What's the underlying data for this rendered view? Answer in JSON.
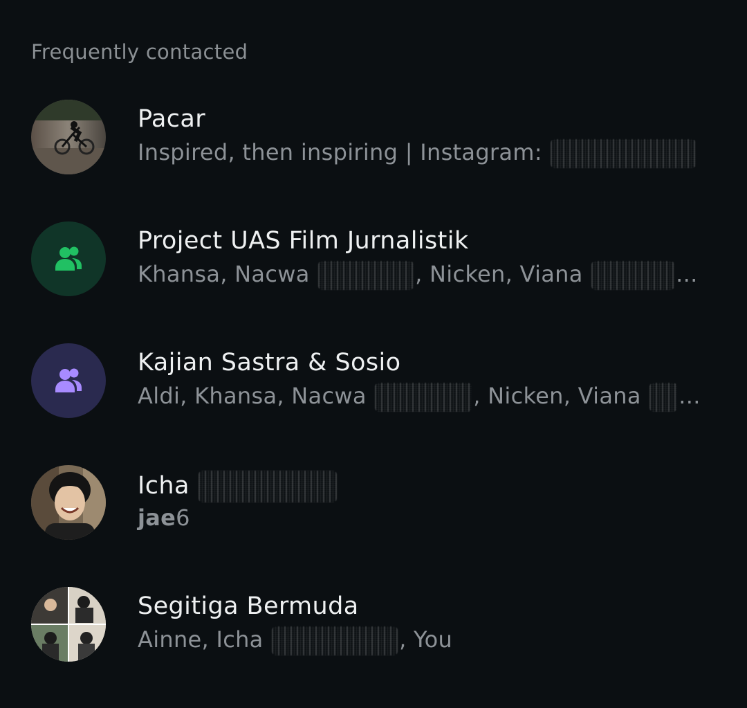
{
  "section": {
    "title": "Frequently contacted"
  },
  "contacts": [
    {
      "name": "Pacar",
      "subtitle": "Inspired, then inspiring | Instagram:",
      "avatar": "photo-cyclist"
    },
    {
      "name": "Project UAS Film Jurnalistik",
      "members_a": "Khansa, Nacwa",
      "members_b": ", Nicken, Viana",
      "ellipsis": "...",
      "avatar": "group-icon",
      "avatar_bg": "#103528",
      "icon_color": "#21c063"
    },
    {
      "name": "Kajian Sastra & Sosio",
      "members_a": "Aldi, Khansa, Nacwa",
      "members_b": ", Nicken, Viana",
      "ellipsis": "...",
      "avatar": "group-icon",
      "avatar_bg": "#2a2a4f",
      "icon_color": "#a88bff"
    },
    {
      "name": "Icha",
      "subtitle_bold": "jae",
      "subtitle_rest": "6",
      "avatar": "photo-person-smiling"
    },
    {
      "name": "Segitiga Bermuda",
      "members_a": "Ainne, Icha",
      "members_b": ", You",
      "avatar": "photo-group-collage"
    }
  ]
}
